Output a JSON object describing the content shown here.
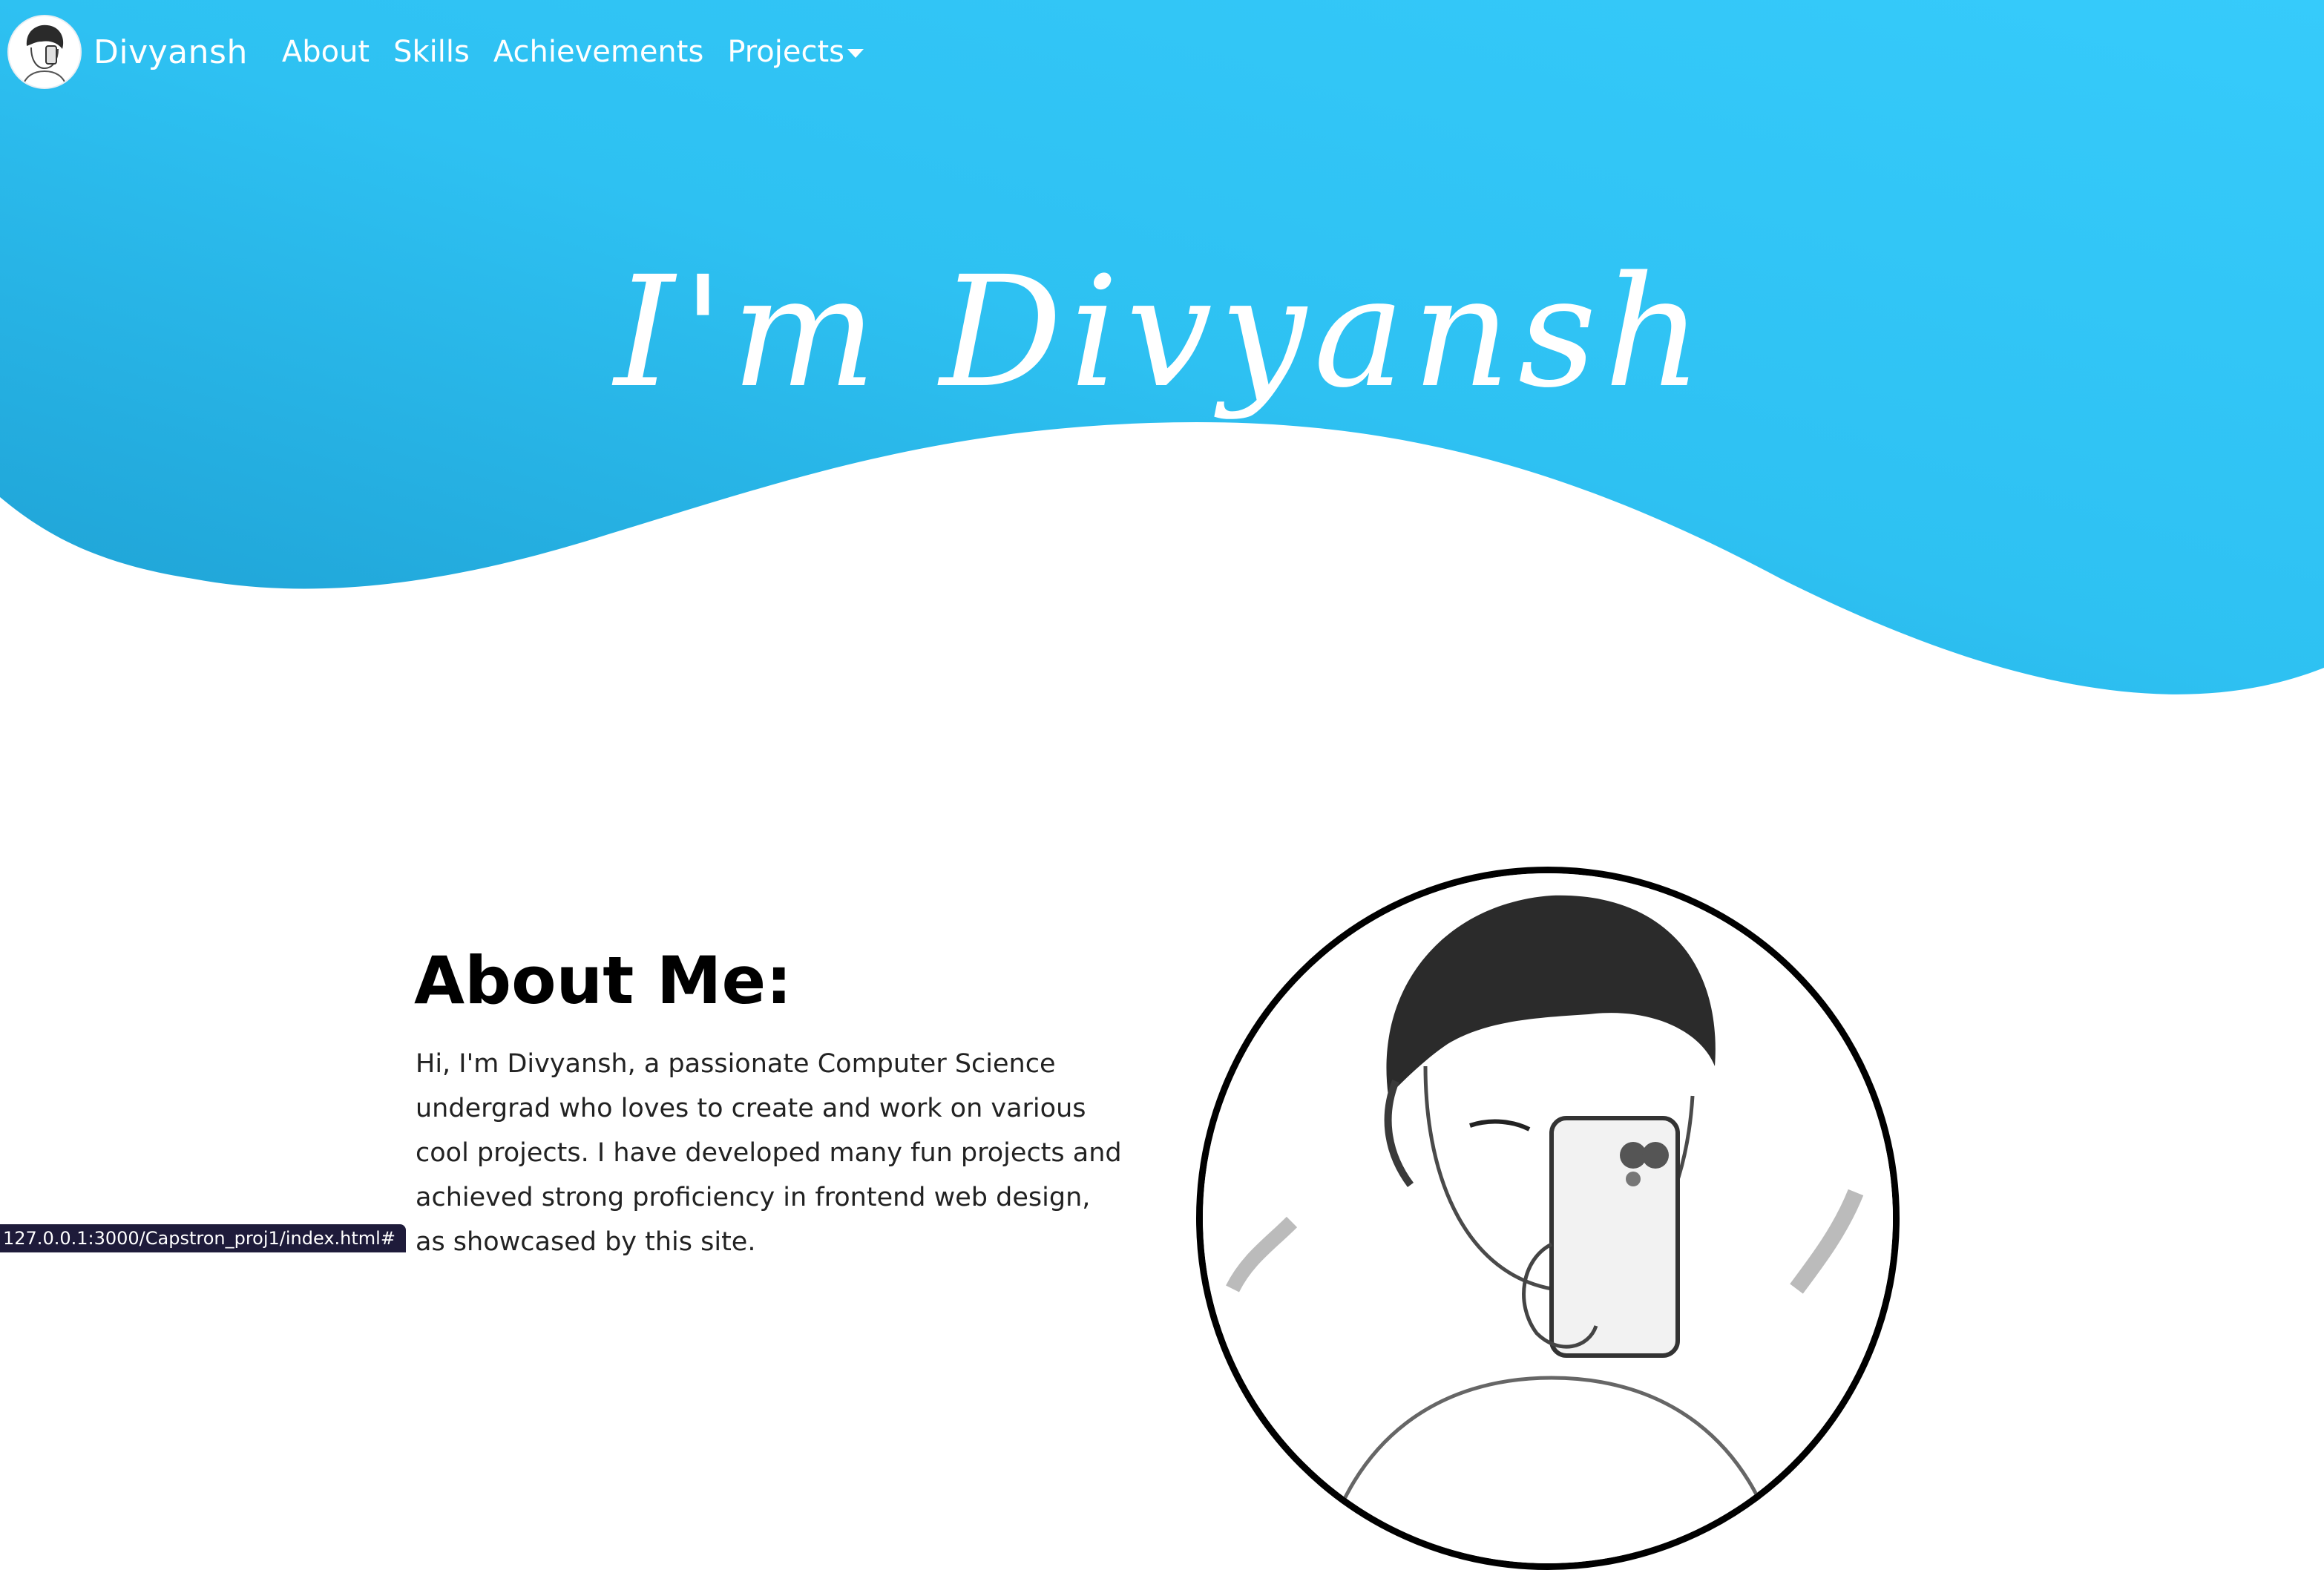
{
  "navbar": {
    "brand_name": "Divyansh",
    "links": [
      {
        "label": "About"
      },
      {
        "label": "Skills"
      },
      {
        "label": "Achievements"
      }
    ],
    "dropdown_label": "Projects"
  },
  "hero": {
    "title": "I'm Divyansh",
    "colors": {
      "start": "#1fa3d6",
      "end": "#36cbfb"
    }
  },
  "about": {
    "heading": "About Me:",
    "text": "Hi, I'm Divyansh, a passionate Computer Science undergrad who loves to create and work on various cool projects. I have developed many fun projects and achieved strong proficiency in frontend web design, as showcased by this site."
  },
  "status_bar": {
    "url": "127.0.0.1:3000/Capstron_proj1/index.html#"
  }
}
